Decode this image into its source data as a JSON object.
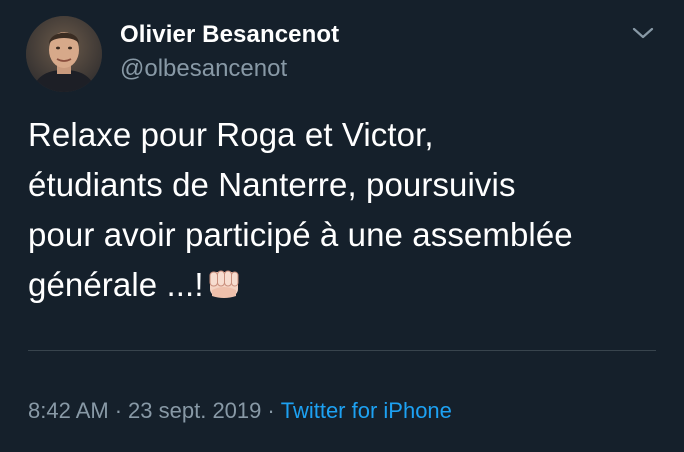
{
  "tweet": {
    "author": {
      "display_name": "Olivier Besancenot",
      "handle": "@olbesancenot"
    },
    "text_lines": [
      "Relaxe pour Roga et Victor,",
      "étudiants de Nanterre, poursuivis",
      "pour avoir participé à une assemblée",
      "générale ...!"
    ],
    "emoji": "fist-emoji",
    "time": "8:42 AM",
    "separator": "·",
    "date": "23 sept. 2019",
    "source": "Twitter for iPhone"
  },
  "icons": {
    "menu": "chevron-down-icon"
  },
  "colors": {
    "background": "#15202b",
    "primary_text": "#ffffff",
    "secondary_text": "#8899a6",
    "link": "#1da1f2",
    "divider": "#38444d"
  }
}
